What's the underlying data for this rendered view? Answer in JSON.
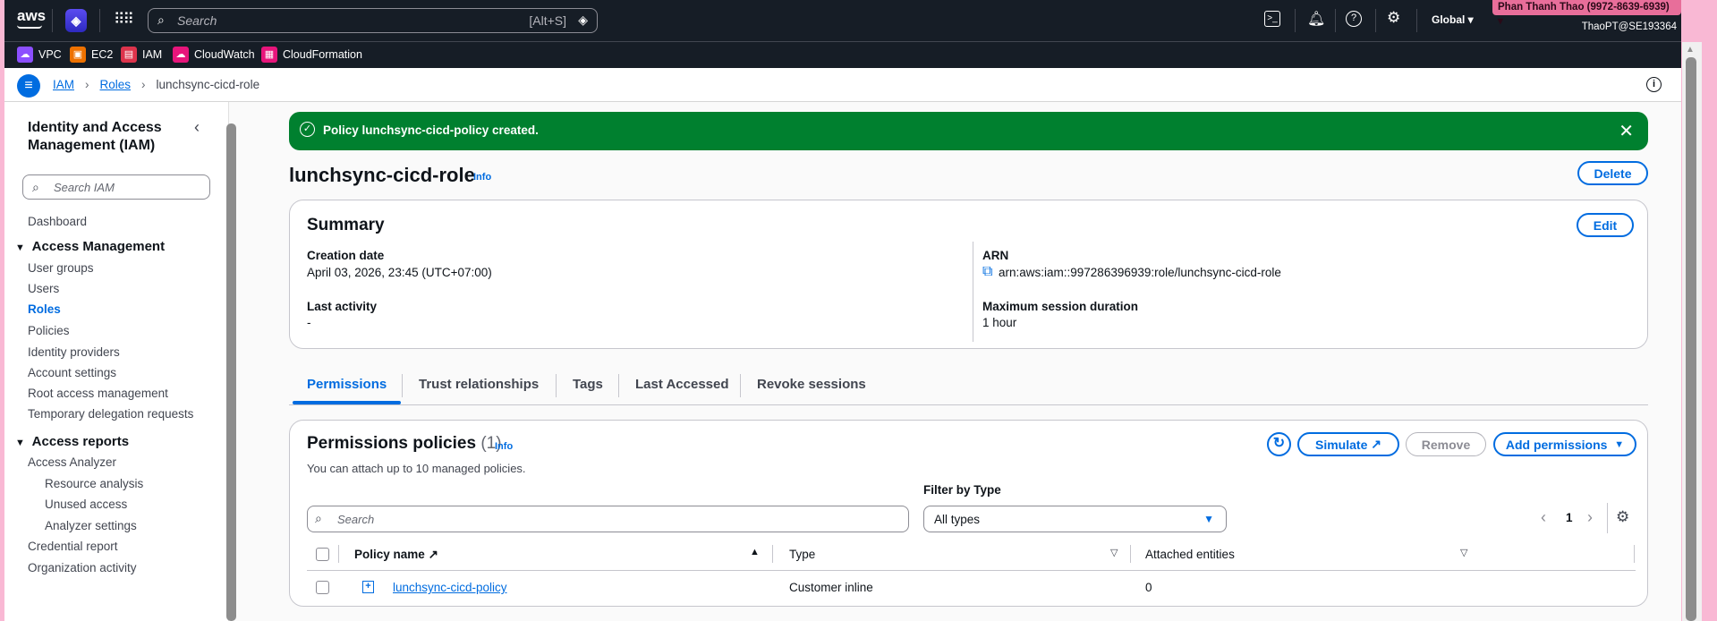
{
  "topbar": {
    "logo": "aws",
    "search_placeholder": "Search",
    "search_shortcut": "[Alt+S]",
    "region": "Global",
    "account": "Phan Thanh Thao (9972-8639-6939)",
    "user": "ThaoPT@SE193364"
  },
  "favorites": [
    {
      "label": "VPC",
      "color": "#8c4fff"
    },
    {
      "label": "EC2",
      "color": "#ed7100"
    },
    {
      "label": "IAM",
      "color": "#dd344c"
    },
    {
      "label": "CloudWatch",
      "color": "#e7157b"
    },
    {
      "label": "CloudFormation",
      "color": "#e7157b"
    }
  ],
  "breadcrumb": {
    "items": [
      "IAM",
      "Roles"
    ],
    "current": "lunchsync-cicd-role"
  },
  "sidebar": {
    "title": "Identity and Access Management (IAM)",
    "search_placeholder": "Search IAM",
    "dashboard": "Dashboard",
    "section1": "Access Management",
    "section1_items": [
      "User groups",
      "Users",
      "Roles",
      "Policies",
      "Identity providers",
      "Account settings",
      "Root access management",
      "Temporary delegation requests"
    ],
    "section2": "Access reports",
    "section2_items": [
      "Access Analyzer",
      "Resource analysis",
      "Unused access",
      "Analyzer settings",
      "Credential report",
      "Organization activity"
    ]
  },
  "flash": {
    "message": "Policy lunchsync-cicd-policy created.",
    "color": "#00802f"
  },
  "page": {
    "title": "lunchsync-cicd-role",
    "info": "Info",
    "delete": "Delete"
  },
  "summary": {
    "title": "Summary",
    "edit": "Edit",
    "creation_label": "Creation date",
    "creation_value": "April 03, 2026, 23:45 (UTC+07:00)",
    "activity_label": "Last activity",
    "activity_value": "-",
    "arn_label": "ARN",
    "arn_value": "arn:aws:iam::997286396939:role/lunchsync-cicd-role",
    "duration_label": "Maximum session duration",
    "duration_value": "1 hour"
  },
  "tabs": [
    "Permissions",
    "Trust relationships",
    "Tags",
    "Last Accessed",
    "Revoke sessions"
  ],
  "permissions": {
    "title": "Permissions policies",
    "count": "(1)",
    "info": "Info",
    "subtitle": "You can attach up to 10 managed policies.",
    "simulate": "Simulate",
    "remove": "Remove",
    "add": "Add permissions",
    "filter_label": "Filter by Type",
    "filter_value": "All types",
    "search_placeholder": "Search",
    "page": "1",
    "columns": [
      "Policy name",
      "Type",
      "Attached entities"
    ],
    "rows": [
      {
        "name": "lunchsync-cicd-policy",
        "type": "Customer inline",
        "attached": "0"
      }
    ]
  }
}
